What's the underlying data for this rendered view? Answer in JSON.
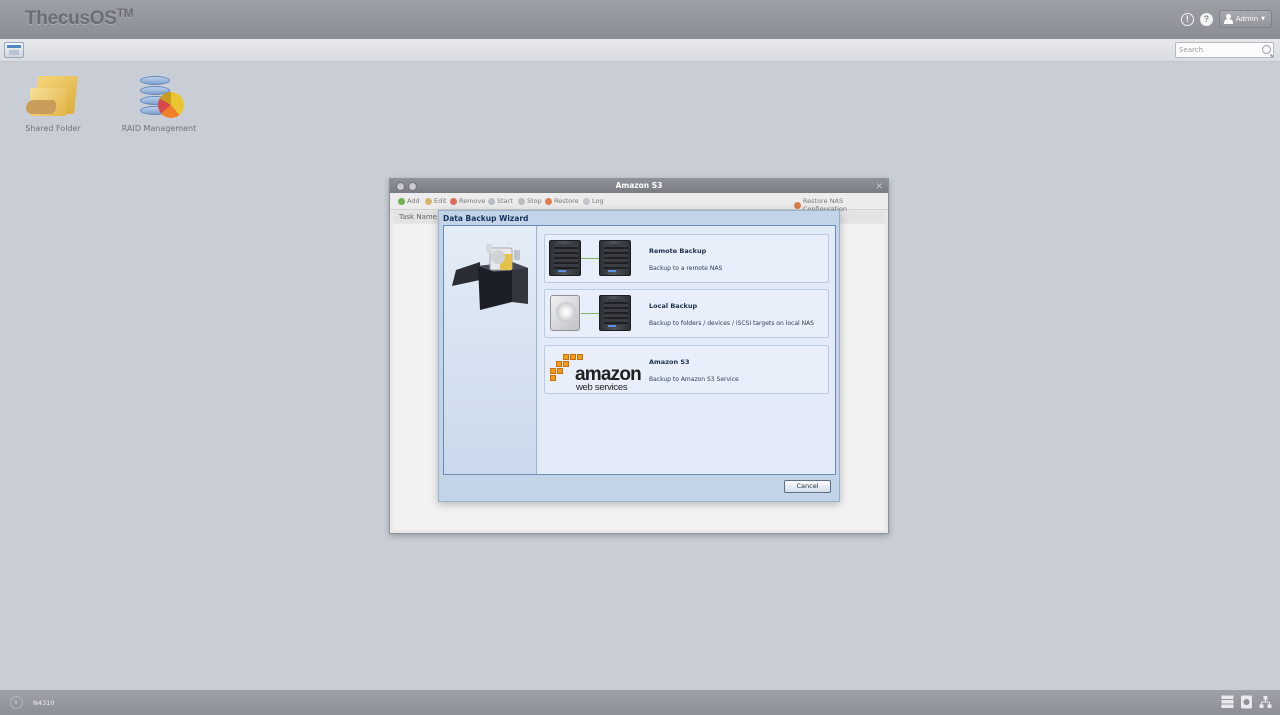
{
  "header": {
    "logo_text": "ThecusOS",
    "logo_tm": "TM",
    "user_label": "Admin"
  },
  "search": {
    "placeholder": "Search"
  },
  "desktop": {
    "icons": [
      {
        "label": "Shared Folder",
        "icon": "shared-folder-icon"
      },
      {
        "label": "RAID Management",
        "icon": "raid-management-icon"
      }
    ]
  },
  "window": {
    "title": "Amazon S3",
    "toolbar": {
      "add": "Add",
      "edit": "Edit",
      "remove": "Remove",
      "start": "Start",
      "stop": "Stop",
      "restore": "Restore",
      "log": "Log",
      "restore_nas": "Restore NAS Configuration"
    },
    "grid": {
      "first_column": "Task Name"
    }
  },
  "wizard": {
    "title": "Data Backup Wizard",
    "options": [
      {
        "title": "Remote Backup",
        "description": "Backup to a remote NAS"
      },
      {
        "title": "Local Backup",
        "description": "Backup to folders / devices / iSCSI targets on local NAS"
      },
      {
        "title": "Amazon S3",
        "description": "Backup to Amazon S3 Service"
      }
    ],
    "aws_logo": {
      "main": "amazon",
      "sub": "web services"
    },
    "cancel_label": "Cancel"
  },
  "footer": {
    "model": "N4310"
  },
  "colors": {
    "accent": "#15325e",
    "header_bg": "#8b8e95",
    "desktop_bg": "#c9ced6"
  }
}
